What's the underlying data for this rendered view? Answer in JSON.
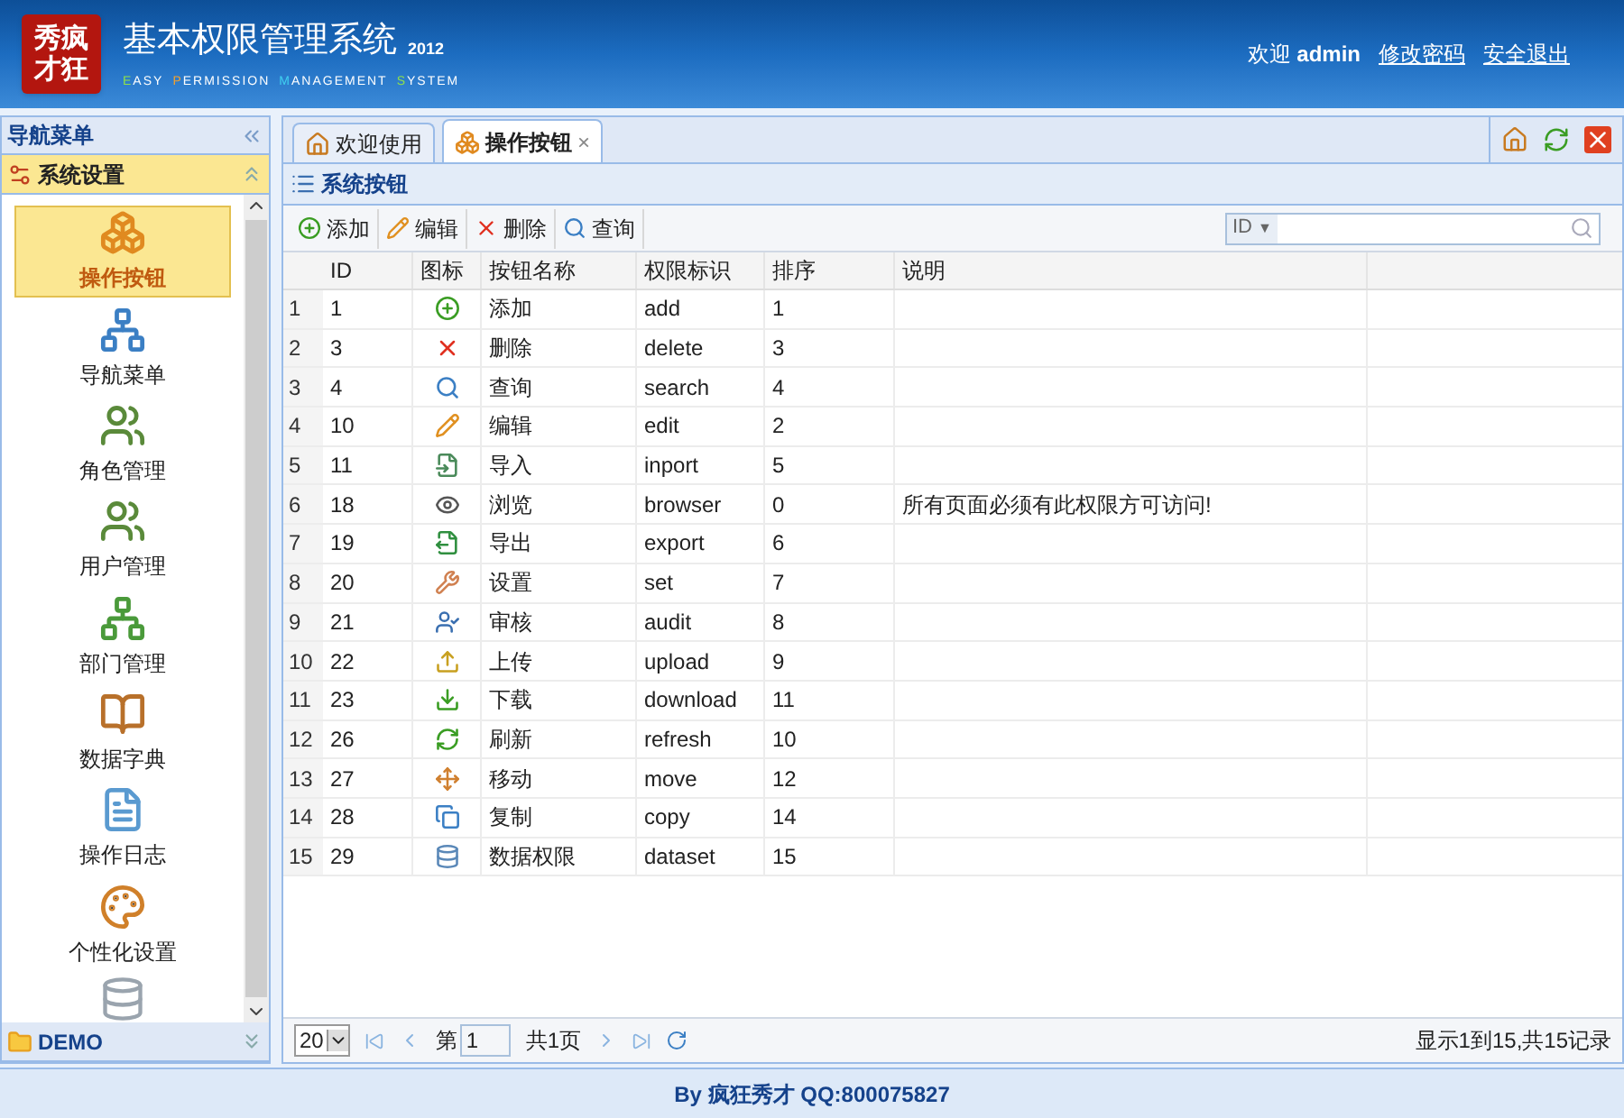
{
  "header": {
    "logo_lines": [
      "秀疯",
      "才狂"
    ],
    "title": "基本权限管理系统",
    "year": "2012",
    "subtitle": [
      {
        "initial": "E",
        "rest": "ASY",
        "color": "#8fe04a"
      },
      {
        "initial": "P",
        "rest": "ERMISSION",
        "color": "#f0a030"
      },
      {
        "initial": "M",
        "rest": "ANAGEMENT",
        "color": "#40d0f0"
      },
      {
        "initial": "S",
        "rest": "YSTEM",
        "color": "#8fe04a"
      }
    ],
    "welcome": "欢迎",
    "user": "admin",
    "links": [
      "修改密码",
      "安全退出"
    ]
  },
  "sidebar": {
    "title": "导航菜单",
    "sections": [
      {
        "label": "系统设置",
        "expanded": true,
        "items": [
          {
            "label": "操作按钮",
            "kind": "boxes",
            "selected": true
          },
          {
            "label": "导航菜单",
            "kind": "tree",
            "selected": false
          },
          {
            "label": "角色管理",
            "kind": "users",
            "selected": false
          },
          {
            "label": "用户管理",
            "kind": "users",
            "selected": false
          },
          {
            "label": "部门管理",
            "kind": "org",
            "selected": false
          },
          {
            "label": "数据字典",
            "kind": "book",
            "selected": false
          },
          {
            "label": "操作日志",
            "kind": "log",
            "selected": false
          },
          {
            "label": "个性化设置",
            "kind": "palette",
            "selected": false
          }
        ]
      },
      {
        "label": "DEMO",
        "expanded": false
      }
    ]
  },
  "tabs": [
    {
      "label": "欢迎使用",
      "kind": "home",
      "selected": false
    },
    {
      "label": "操作按钮",
      "kind": "boxes",
      "selected": true,
      "close": "×"
    }
  ],
  "panel": {
    "title": "系统按钮",
    "toolbar": [
      {
        "label": "添加",
        "kind": "add"
      },
      {
        "label": "编辑",
        "kind": "edit"
      },
      {
        "label": "删除",
        "kind": "delete"
      },
      {
        "label": "查询",
        "kind": "search"
      }
    ],
    "search": {
      "field": "ID",
      "caret": "▼"
    },
    "table": {
      "columns": [
        "ID",
        "图标",
        "按钮名称",
        "权限标识",
        "排序",
        "说明"
      ],
      "rows": [
        {
          "num": "1",
          "id": "1",
          "kind": "add",
          "name": "添加",
          "code": "add",
          "order": "1"
        },
        {
          "num": "2",
          "id": "3",
          "kind": "delete",
          "name": "删除",
          "code": "delete",
          "order": "3"
        },
        {
          "num": "3",
          "id": "4",
          "kind": "search",
          "name": "查询",
          "code": "search",
          "order": "4"
        },
        {
          "num": "4",
          "id": "10",
          "kind": "edit",
          "name": "编辑",
          "code": "edit",
          "order": "2"
        },
        {
          "num": "5",
          "id": "11",
          "kind": "import",
          "name": "导入",
          "code": "inport",
          "order": "5"
        },
        {
          "num": "6",
          "id": "18",
          "kind": "view",
          "name": "浏览",
          "code": "browser",
          "order": "0",
          "note": "所有页面必须有此权限方可访问!"
        },
        {
          "num": "7",
          "id": "19",
          "kind": "export",
          "name": "导出",
          "code": "export",
          "order": "6"
        },
        {
          "num": "8",
          "id": "20",
          "kind": "set",
          "name": "设置",
          "code": "set",
          "order": "7"
        },
        {
          "num": "9",
          "id": "21",
          "kind": "audit",
          "name": "审核",
          "code": "audit",
          "order": "8"
        },
        {
          "num": "10",
          "id": "22",
          "kind": "upload",
          "name": "上传",
          "code": "upload",
          "order": "9"
        },
        {
          "num": "11",
          "id": "23",
          "kind": "download",
          "name": "下载",
          "code": "download",
          "order": "11"
        },
        {
          "num": "12",
          "id": "26",
          "kind": "refresh",
          "name": "刷新",
          "code": "refresh",
          "order": "10"
        },
        {
          "num": "13",
          "id": "27",
          "kind": "move",
          "name": "移动",
          "code": "move",
          "order": "12"
        },
        {
          "num": "14",
          "id": "28",
          "kind": "copy",
          "name": "复制",
          "code": "copy",
          "order": "14"
        },
        {
          "num": "15",
          "id": "29",
          "kind": "dataset",
          "name": "数据权限",
          "code": "dataset",
          "order": "15"
        }
      ]
    },
    "pager": {
      "page_size": "20",
      "page_prefix": "第",
      "page": "1",
      "page_total": "共1页",
      "summary": "显示1到15,共15记录"
    }
  },
  "footer": "By 疯狂秀才 QQ:800075827"
}
